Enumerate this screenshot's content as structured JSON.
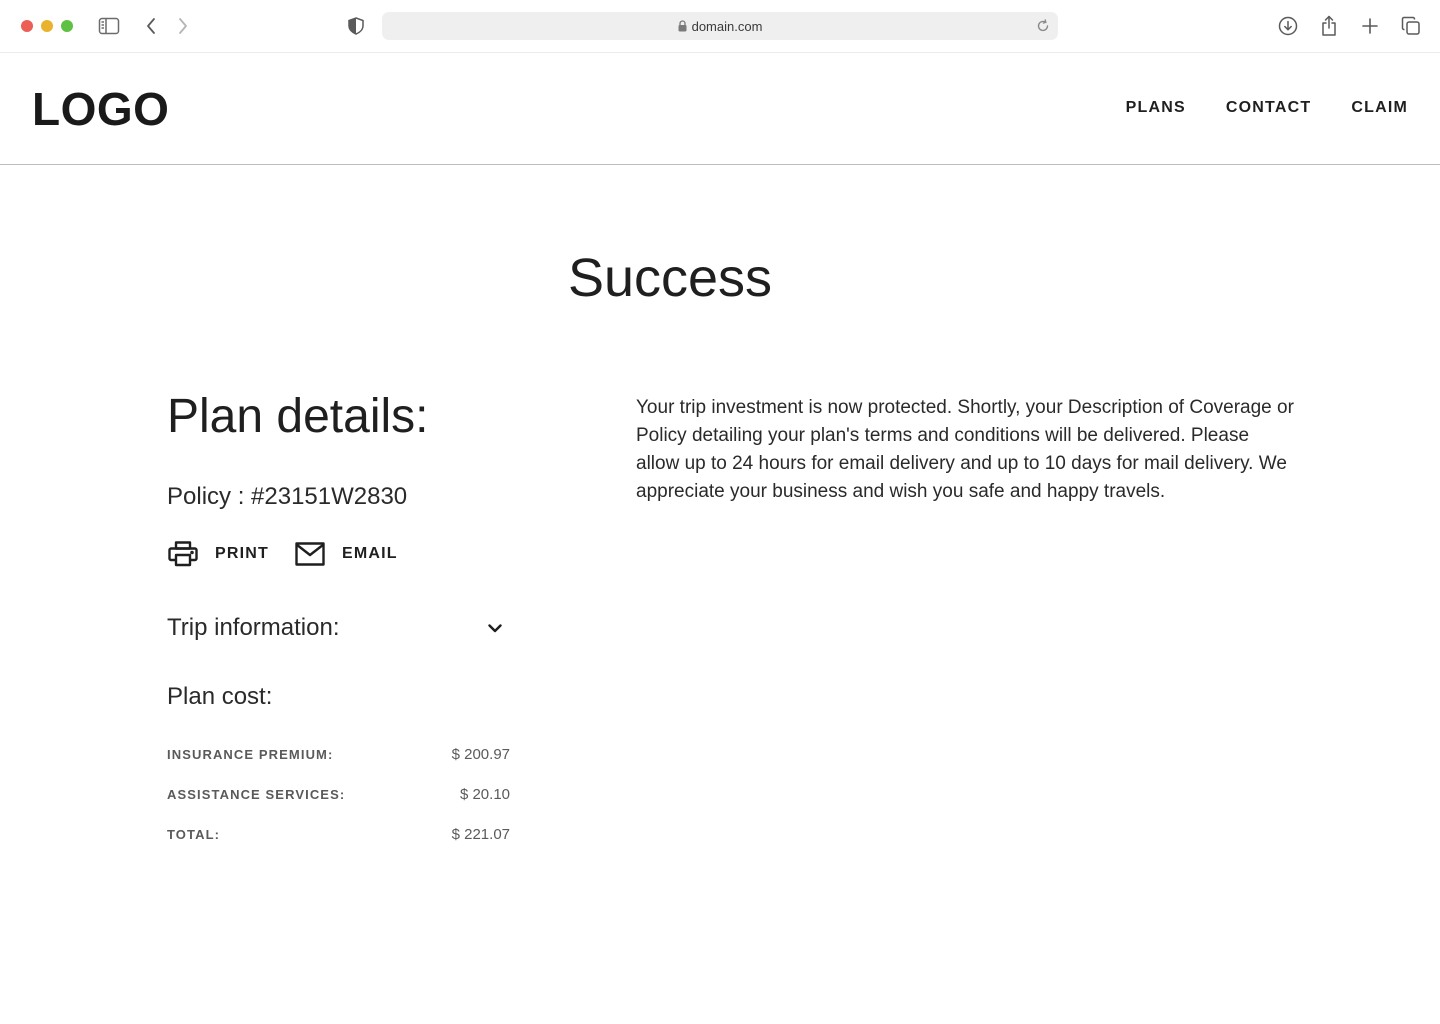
{
  "browser": {
    "url": "domain.com"
  },
  "header": {
    "logo": "LOGO",
    "nav": [
      {
        "label": "PLANS"
      },
      {
        "label": "CONTACT"
      },
      {
        "label": "CLAIM"
      }
    ]
  },
  "main": {
    "title": "Success",
    "plan_details": {
      "heading": "Plan details:",
      "policy": "Policy : #23151W2830",
      "actions": {
        "print_label": "PRINT",
        "email_label": "EMAIL"
      },
      "trip_information": "Trip information:",
      "plan_cost": {
        "heading": "Plan cost:",
        "rows": [
          {
            "label": "INSURANCE PREMIUM:",
            "value": "$ 200.97"
          },
          {
            "label": "ASSISTANCE SERVICES:",
            "value": "$ 20.10"
          },
          {
            "label": "TOTAL:",
            "value": "$ 221.07"
          }
        ]
      }
    },
    "message": "Your trip investment is now protected. Shortly, your Description of Coverage or Policy detailing your plan's terms and conditions will be delivered. Please allow up to 24 hours for email delivery and up to 10 days for mail delivery. We appreciate your business and wish you safe and happy travels."
  },
  "icons": {
    "browser": [
      "sidebar-icon",
      "back-icon",
      "forward-icon",
      "shield-icon",
      "lock-icon",
      "reload-icon",
      "download-icon",
      "share-icon",
      "new-tab-icon",
      "tabs-icon"
    ],
    "page": [
      "printer-icon",
      "mail-icon",
      "chevron-down-icon"
    ]
  },
  "colors": {
    "text": "#1f1f1f",
    "muted": "#5a5a5a",
    "divider": "#bdbdbd"
  }
}
